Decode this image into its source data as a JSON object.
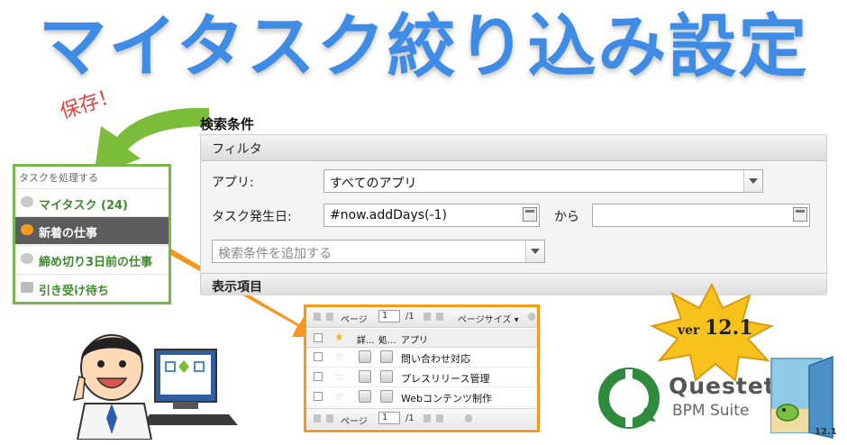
{
  "headline": "マイタスク絞り込み設定",
  "save_note": "保存！",
  "search_panel": {
    "title": "検索条件",
    "filter_header": "フィルタ",
    "app_label": "アプリ:",
    "app_value": "すべてのアプリ",
    "date_label": "タスク発生日:",
    "date_from_value": "#now.addDays(-1)",
    "date_separator": "から",
    "date_to_value": "",
    "add_condition_placeholder": "検索条件を追加する",
    "display_header": "表示項目"
  },
  "task_menu": {
    "caption": "タスクを処理する",
    "items": [
      {
        "label": "マイタスク (24)"
      },
      {
        "label": "新着の仕事"
      },
      {
        "label": "締め切り3日前の仕事"
      },
      {
        "label": "引き受け待ち"
      }
    ]
  },
  "task_table": {
    "pager_page_label": "ページ",
    "pager_page_value": "1",
    "pager_total": "/1",
    "pager_size_label": "ページサイズ ▾",
    "headers": [
      "詳...",
      "処...",
      "アプリ"
    ],
    "rows": [
      {
        "app": "問い合わせ対応"
      },
      {
        "app": "プレスリリース管理"
      },
      {
        "app": "Webコンテンツ制作"
      }
    ]
  },
  "version_badge": {
    "prefix": "ver",
    "number": "12.1"
  },
  "brand": {
    "name": "Questetra",
    "suite": "BPM Suite",
    "door_version": "12.1"
  },
  "colors": {
    "headline": "#3f8ce6",
    "menu_border": "#78b84a",
    "table_border": "#f39a1f",
    "arrow_green": "#7bbd3a",
    "arrow_orange": "#f5971f",
    "badge_gold": "#f6c21b"
  },
  "icons": [
    "green-arrow-icon",
    "orange-arrow-icon",
    "star-icon",
    "calendar-icon",
    "chevron-down-icon"
  ]
}
